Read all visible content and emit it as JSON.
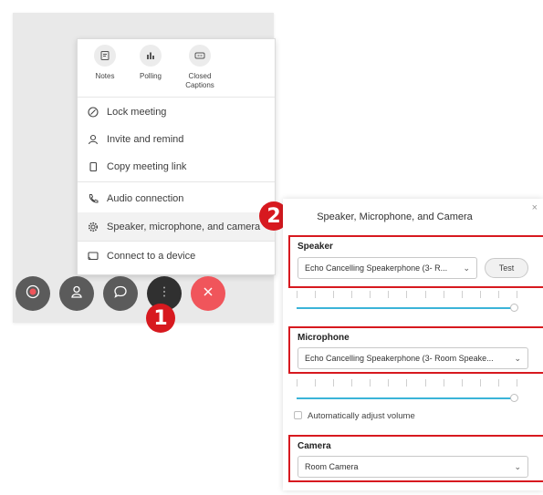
{
  "menu": {
    "quick_actions": [
      {
        "label": "Notes",
        "icon": "notes-icon"
      },
      {
        "label": "Polling",
        "icon": "polling-icon"
      },
      {
        "label": "Closed Captions",
        "icon": "closed-captions-icon"
      }
    ],
    "items": [
      {
        "label": "Lock meeting",
        "icon": "lock-meeting-icon"
      },
      {
        "label": "Invite and remind",
        "icon": "invite-icon"
      },
      {
        "label": "Copy meeting link",
        "icon": "copy-icon"
      },
      {
        "label": "Audio connection",
        "icon": "phone-icon"
      },
      {
        "label": "Speaker, microphone, and camera",
        "icon": "gear-icon"
      },
      {
        "label": "Connect to a device",
        "icon": "cast-icon"
      }
    ]
  },
  "controls": [
    {
      "name": "record",
      "icon": "record-icon"
    },
    {
      "name": "participants",
      "icon": "participants-icon"
    },
    {
      "name": "chat",
      "icon": "chat-icon"
    },
    {
      "name": "more",
      "icon": "more-icon"
    },
    {
      "name": "leave",
      "icon": "close-icon"
    }
  ],
  "badges": {
    "step1": "1",
    "step2": "2"
  },
  "dialog": {
    "title": "Speaker, Microphone, and Camera",
    "close": "×",
    "speaker": {
      "title": "Speaker",
      "device": "Echo Cancelling Speakerphone (3- R...",
      "test_label": "Test",
      "volume": 0.97
    },
    "microphone": {
      "title": "Microphone",
      "device": "Echo Cancelling Speakerphone (3- Room Speake...",
      "volume": 0.97,
      "auto_adjust_label": "Automatically adjust volume",
      "auto_adjust_checked": false
    },
    "camera": {
      "title": "Camera",
      "device": "Room Camera"
    }
  },
  "colors": {
    "accent_red": "#d7191f",
    "end_call": "#f0555b",
    "slider": "#3bb4d8",
    "control_gray": "#5b5b5b"
  }
}
